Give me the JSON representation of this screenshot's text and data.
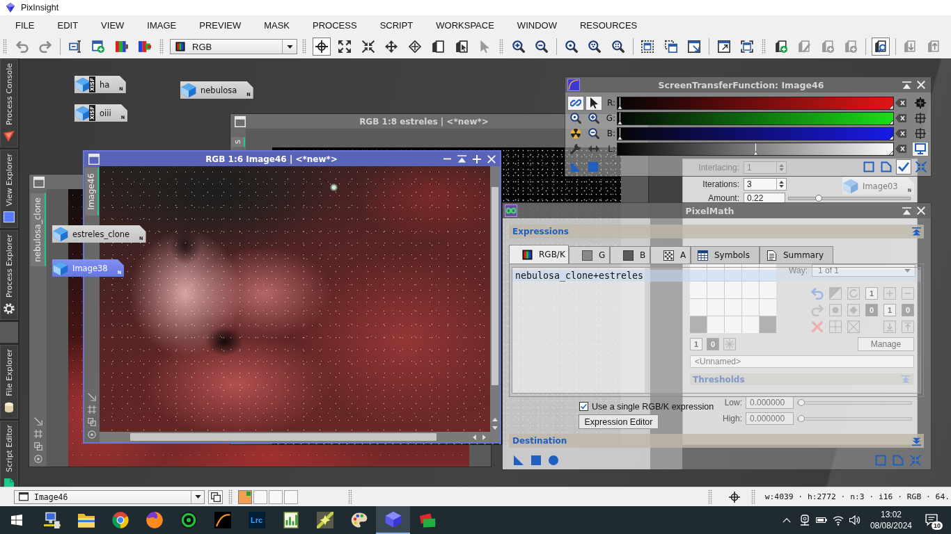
{
  "app": {
    "title": "PixInsight"
  },
  "menu": [
    "FILE",
    "EDIT",
    "VIEW",
    "IMAGE",
    "PREVIEW",
    "MASK",
    "PROCESS",
    "SCRIPT",
    "WORKSPACE",
    "WINDOW",
    "RESOURCES"
  ],
  "toolbar": {
    "view_mode": "RGB",
    "mode_buttons": [
      {
        "selected": true
      },
      {
        "selected": false
      },
      {
        "selected": false
      },
      {
        "selected": false
      },
      {
        "selected": false
      },
      {
        "selected": false
      },
      {
        "selected": false
      },
      {
        "selected": false
      }
    ],
    "explorer_button": {
      "on": true
    }
  },
  "side_tabs": [
    {
      "label": "Process Console"
    },
    {
      "label": "View Explorer"
    },
    {
      "label": "Process Explorer"
    },
    {
      "label": "File Explorer"
    },
    {
      "label": "Script Editor"
    }
  ],
  "desktop_icons": [
    {
      "label": "ha",
      "badge": "XISF",
      "flag": "N",
      "selected": false
    },
    {
      "label": "oiii",
      "badge": "XISF",
      "flag": "N",
      "selected": false
    },
    {
      "label": "nebulosa",
      "flag": "N",
      "selected": false
    },
    {
      "label": "Image03",
      "flag": "N",
      "selected": false
    },
    {
      "label": "estreles_clone",
      "flag": "N",
      "selected": false
    },
    {
      "label": "Image38",
      "flag": "N",
      "selected": true
    }
  ],
  "image_windows": [
    {
      "tab": "nebulosa_clone",
      "active": false
    },
    {
      "title": "RGB 1:8 estreles | <*new*>",
      "tab": "s",
      "active": false
    },
    {
      "title": "RGB 1:6 Image46 | <*new*>",
      "tab": "Image46",
      "active": true
    }
  ],
  "morphological_window": {
    "interlacing": {
      "label": "Interlacing:",
      "value": "1",
      "disabled": true
    },
    "iterations": {
      "label": "Iterations:",
      "value": "3",
      "disabled": false
    },
    "amount": {
      "label": "Amount:",
      "value": "0.22",
      "level": 0.23
    },
    "way": {
      "label": "Way:",
      "value": "1 of 1"
    },
    "kernel": [
      [
        true,
        true,
        true,
        true,
        true
      ],
      [
        true,
        true,
        true,
        true,
        true
      ],
      [
        true,
        true,
        true,
        true,
        true
      ],
      [
        false,
        true,
        true,
        true,
        false
      ]
    ],
    "tool_digits": [
      {
        "label": "1",
        "filled": false
      },
      {
        "label": "0",
        "filled": true
      },
      {
        "label": "1",
        "filled": false
      },
      {
        "label": "0",
        "filled": true
      }
    ],
    "element_digits": [
      {
        "label": "1",
        "filled": false
      },
      {
        "label": "0",
        "filled": true
      }
    ],
    "manage_button": "Manage",
    "name_field": {
      "placeholder": "<Unnamed>"
    },
    "thresholds_header": "Thresholds",
    "low": {
      "label": "Low:",
      "value": "0.000000",
      "level": 0,
      "disabled": true
    },
    "high": {
      "label": "High:",
      "value": "0.000000",
      "level": 0,
      "disabled": true
    }
  },
  "stf": {
    "title": "ScreenTransferFunction: Image46",
    "tools": [
      {
        "on": true
      },
      {
        "on": true
      },
      {
        "on": false
      },
      {
        "on": false
      },
      {
        "on": false
      },
      {
        "on": false
      },
      {
        "on": false
      },
      {
        "on": false
      }
    ],
    "channels": [
      {
        "label": "R:",
        "kind": "red",
        "level": 0,
        "selected": true
      },
      {
        "label": "G:",
        "kind": "green",
        "level": 0,
        "selected": false
      },
      {
        "label": "B:",
        "kind": "blue",
        "level": 0,
        "selected": false
      },
      {
        "label": "L:",
        "kind": "luminance",
        "level": 0.5,
        "selected": true
      }
    ],
    "bottom_buttons": [
      {
        "on": false
      },
      {
        "on": false
      },
      {
        "on": true
      },
      {
        "on": false
      }
    ]
  },
  "pixelmath": {
    "title": "PixelMath",
    "expressions_header": "Expressions",
    "tabs": [
      {
        "label": "RGB/K",
        "selected": true
      },
      {
        "label": "G",
        "selected": false
      },
      {
        "label": "B",
        "selected": false
      },
      {
        "label": "A",
        "selected": false
      },
      {
        "label": "Symbols",
        "selected": false
      },
      {
        "label": "Summary",
        "selected": false
      }
    ],
    "expression": "nebulosa_clone+estreles",
    "single_expression": {
      "label": "Use a single RGB/K expression",
      "checked": true
    },
    "editor_button": "Expression Editor",
    "destination_header": "Destination"
  },
  "status_bar": {
    "view": "Image46",
    "mask_slots": [
      {
        "on": true
      },
      {
        "on": false
      },
      {
        "on": false
      },
      {
        "on": false
      }
    ],
    "readout": "w:4039 · h:2772 · n:3 · i16 · RGB · 64."
  },
  "taskbar": {
    "apps": [
      {
        "selected": false
      },
      {
        "selected": false
      },
      {
        "selected": false
      },
      {
        "selected": false
      },
      {
        "selected": false
      },
      {
        "selected": false
      },
      {
        "label": "Lrc",
        "selected": false
      },
      {
        "selected": false
      },
      {
        "selected": false
      },
      {
        "selected": false
      },
      {
        "selected": true
      },
      {
        "selected": false
      }
    ],
    "time": "13:02",
    "date": "08/08/2024",
    "notifications": "10"
  }
}
